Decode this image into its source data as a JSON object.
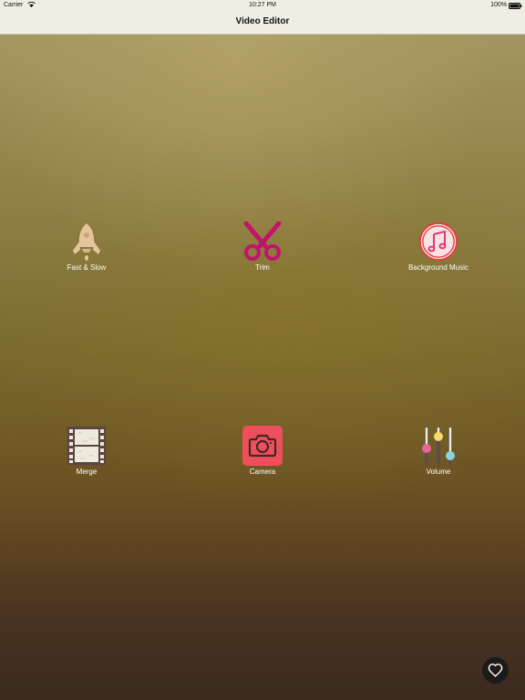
{
  "status_bar": {
    "carrier": "Carrier",
    "time": "10:27 PM",
    "battery": "100%"
  },
  "nav": {
    "title": "Video Editor"
  },
  "tools": [
    {
      "label": "Fast & Slow",
      "icon": "rocket-icon"
    },
    {
      "label": "Trim",
      "icon": "scissors-icon"
    },
    {
      "label": "Background Music",
      "icon": "music-note-icon"
    },
    {
      "label": "Merge",
      "icon": "film-strip-icon"
    },
    {
      "label": "Camera",
      "icon": "camera-icon"
    },
    {
      "label": "Volume",
      "icon": "volume-sliders-icon"
    }
  ],
  "favorite": {
    "icon": "heart-icon"
  },
  "colors": {
    "bar_background": "#efeee3",
    "rocket": "#e4c49c",
    "scissors": "#c4126e",
    "music": "#e5383b",
    "camera": "#ef4f5a",
    "film": "#5a4642"
  }
}
